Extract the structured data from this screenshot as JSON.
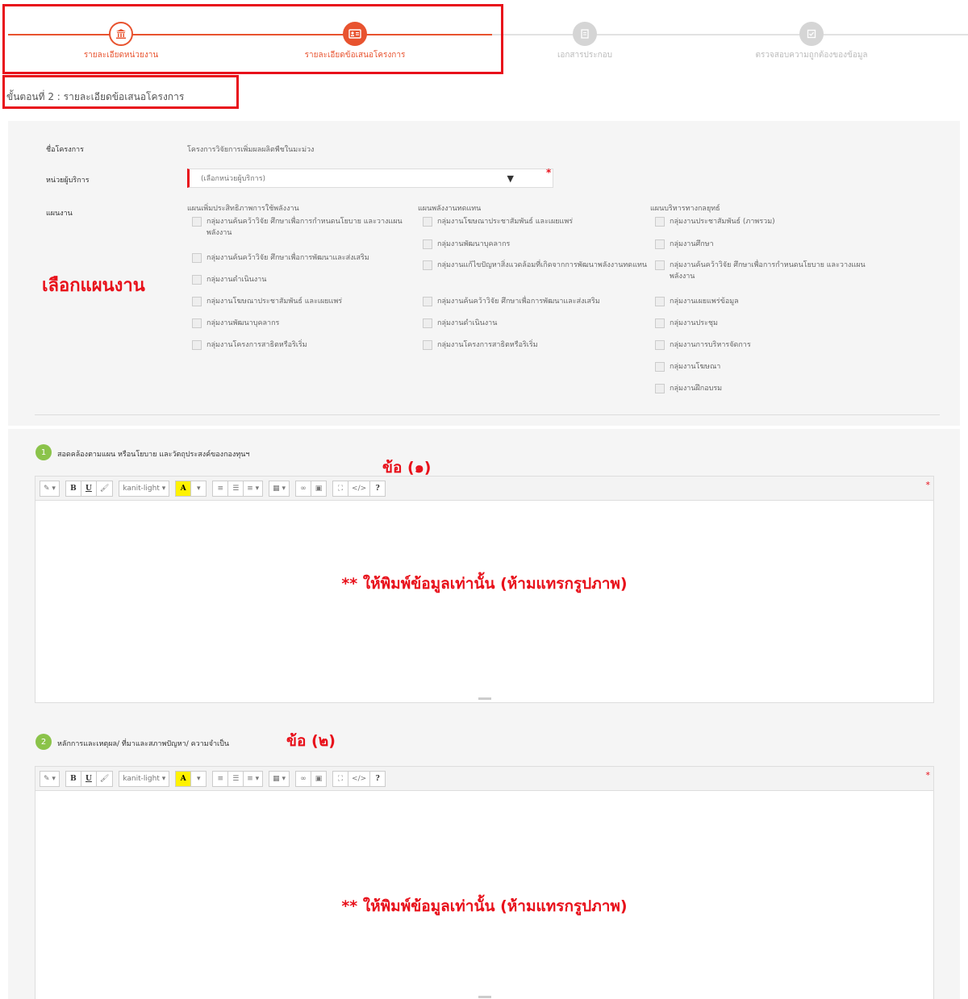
{
  "stepper": {
    "steps": [
      {
        "label": "รายละเอียดหน่วยงาน",
        "icon": "bank-icon",
        "state": "done"
      },
      {
        "label": "รายละเอียดข้อเสนอโครงการ",
        "icon": "id-card-icon",
        "state": "active"
      },
      {
        "label": "เอกสารประกอบ",
        "icon": "document-icon",
        "state": "pending"
      },
      {
        "label": "ตรวจสอบความถูกต้องของข้อมูล",
        "icon": "check-icon",
        "state": "pending"
      }
    ],
    "subtitle": "ขั้นตอนที่ 2 : รายละเอียดข้อเสนอโครงการ"
  },
  "form": {
    "project_name_label": "ชื่อโครงการ",
    "project_name_value": "โครงการวิจัยการเพิ่มผลผลิตพืชในมะม่วง",
    "unit_label": "หน่วยผู้บริการ",
    "unit_placeholder": "(เลือกหน่วยผู้บริการ)",
    "plan_label": "แผนงาน",
    "plan_annotation": "เลือกแผนงาน",
    "columns": [
      {
        "heading": "แผนเพิ่มประสิทธิภาพการใช้พลังงาน",
        "items": [
          "กลุ่มงานค้นคว้าวิจัย ศึกษาเพื่อการกำหนดนโยบาย และวางแผนพลังงาน",
          "กลุ่มงานค้นคว้าวิจัย ศึกษาเพื่อการพัฒนาและส่งเสริม",
          "กลุ่มงานดำเนินงาน",
          "กลุ่มงานโฆษณาประชาสัมพันธ์ และเผยแพร่",
          "กลุ่มงานพัฒนาบุคลากร",
          "กลุ่มงานโครงการสาธิตหรือริเริ่ม"
        ]
      },
      {
        "heading": "แผนพลังงานทดแทน",
        "items": [
          "กลุ่มงานโฆษณาประชาสัมพันธ์ และเผยแพร่",
          "กลุ่มงานพัฒนาบุคลากร",
          "กลุ่มงานแก้ไขปัญหาสิ่งแวดล้อมที่เกิดจากการพัฒนาพลังงานทดแทน",
          "กลุ่มงานค้นคว้าวิจัย ศึกษาเพื่อการพัฒนาและส่งเสริม",
          "กลุ่มงานดำเนินงาน",
          "กลุ่มงานโครงการสาธิตหรือริเริ่ม"
        ]
      },
      {
        "heading": "แผนบริหารทางกลยุทธ์",
        "items": [
          "กลุ่มงานประชาสัมพันธ์ (ภาพรวม)",
          "กลุ่มงานศึกษา",
          "กลุ่มงานค้นคว้าวิจัย ศึกษาเพื่อการกำหนดนโยบาย และวางแผนพลังงาน",
          "กลุ่มงานเผยแพร่ข้อมูล",
          "กลุ่มงานประชุม",
          "กลุ่มงานการบริหารจัดการ",
          "กลุ่มงานโฆษณา",
          "กลุ่มงานฝึกอบรม"
        ]
      }
    ]
  },
  "sections": [
    {
      "number": "1",
      "title": "สอดคล้องตามแผน หรือนโยบาย และวัตถุประสงค์ของกองทุนฯ",
      "annotation": "ข้อ (๑)",
      "note": "** ให้พิมพ์ข้อมูลเท่านั้น (ห้ามแทรกรูปภาพ)"
    },
    {
      "number": "2",
      "title": "หลักการและเหตุผล/ ที่มาและสภาพปัญหา/ ความจำเป็น",
      "annotation": "ข้อ (๒)",
      "note": "** ให้พิมพ์ข้อมูลเท่านั้น (ห้ามแทรกรูปภาพ)"
    }
  ],
  "toolbar": {
    "magic": "✎ ▾",
    "bold": "B",
    "underline": "U",
    "eraser": "🖌",
    "font": "kanit-light ▾",
    "color": "A",
    "color_caret": "▾",
    "ul": "≡",
    "ol": "☰",
    "align": "≡ ▾",
    "table": "▦ ▾",
    "link": "∞",
    "picture": "▣",
    "fullscreen": "⛶",
    "code": "</>",
    "help": "?"
  },
  "colors": {
    "accent": "#e8532f",
    "annotation_red": "#e8101a",
    "badge_green": "#8bc34a",
    "pending_gray": "#d5d5d5"
  }
}
